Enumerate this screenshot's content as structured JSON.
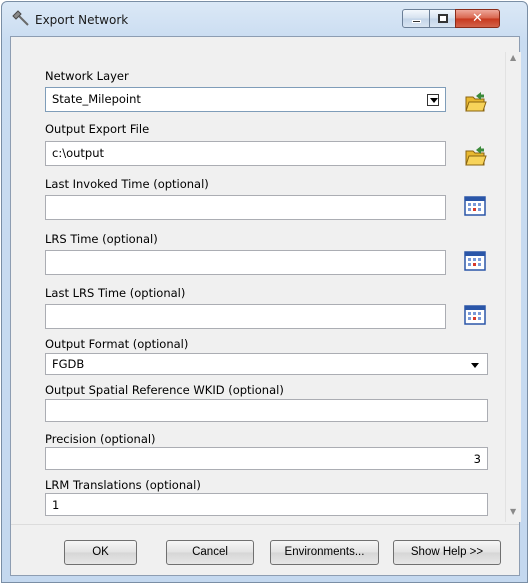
{
  "window": {
    "title": "Export Network",
    "close_glyph": "✕"
  },
  "form": {
    "network_layer": {
      "label": "Network Layer",
      "value": "State_Milepoint"
    },
    "output_export_file": {
      "label": "Output Export File",
      "value": "c:\\output"
    },
    "last_invoked_time": {
      "label": "Last Invoked Time (optional)",
      "value": ""
    },
    "lrs_time": {
      "label": "LRS Time (optional)",
      "value": ""
    },
    "last_lrs_time": {
      "label": "Last LRS Time (optional)",
      "value": ""
    },
    "output_format": {
      "label": "Output Format (optional)",
      "value": "FGDB"
    },
    "output_spatial_reference": {
      "label": "Output Spatial Reference WKID (optional)",
      "value": ""
    },
    "precision": {
      "label": "Precision (optional)",
      "value": "3"
    },
    "lrm_translations": {
      "label": "LRM Translations (optional)",
      "value": "1"
    }
  },
  "buttons": {
    "ok": "OK",
    "cancel": "Cancel",
    "environments": "Environments...",
    "show_help": "Show Help >>"
  },
  "icons": {
    "window": "tool-hammer-icon",
    "browse": "open-folder-icon",
    "calendar": "calendar-icon"
  }
}
